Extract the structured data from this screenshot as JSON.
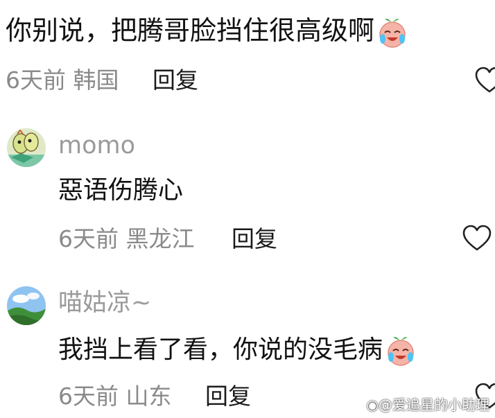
{
  "comments": [
    {
      "text": "你别说，把腾哥脸挡住很高级啊",
      "meta": "6天前 韩国",
      "reply_label": "回复",
      "emoji": "laughing-crying-peach-emoji"
    },
    {
      "username": "momo",
      "text": "惡语伤腾心",
      "meta": "6天前 黑龙江",
      "reply_label": "回复",
      "avatar": "cartoon-avatar"
    },
    {
      "username": "喵姑凉~",
      "text": "我挡上看了看，你说的没毛病",
      "meta": "6天前 山东",
      "reply_label": "回复",
      "avatar": "landscape-avatar",
      "emoji": "laughing-crying-peach-emoji"
    }
  ],
  "watermark": "@爱追星的小助理",
  "colors": {
    "meta": "#8a8a8a",
    "username": "#9a9a9a",
    "text": "#111111",
    "heart_stroke": "#222222"
  }
}
